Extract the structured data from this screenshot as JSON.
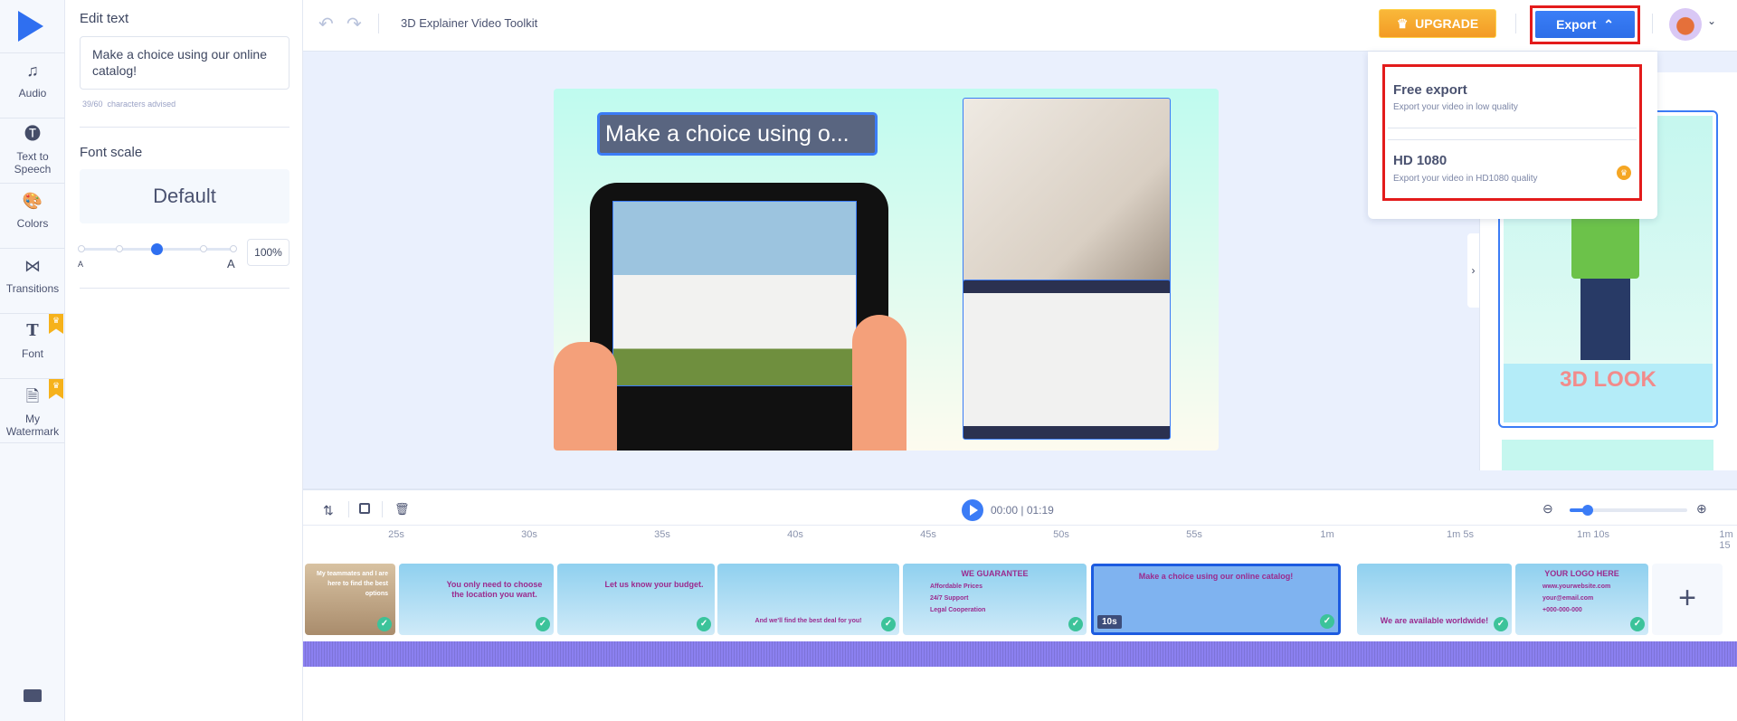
{
  "sidebar": {
    "items": [
      {
        "label": "Audio",
        "icon": "music-note-icon"
      },
      {
        "label": "Text to Speech",
        "icon": "text-speech-icon"
      },
      {
        "label": "Colors",
        "icon": "palette-icon"
      },
      {
        "label": "Transitions",
        "icon": "bowtie-icon"
      },
      {
        "label": "Font",
        "icon": "font-icon",
        "premium": true
      },
      {
        "label": "My Watermark",
        "icon": "watermark-icon",
        "premium": true
      }
    ]
  },
  "panel": {
    "edit_text_label": "Edit text",
    "text_value": "Make a choice using our online catalog!",
    "char_count": "39/60",
    "char_hint": "characters advised",
    "font_scale_label": "Font scale",
    "font_scale_value": "Default",
    "slider_min_label": "A",
    "slider_max_label": "A",
    "slider_percent": "100%",
    "slider_step": 3,
    "slider_steps": 5
  },
  "header": {
    "title": "3D Explainer Video Toolkit",
    "upgrade_label": "UPGRADE",
    "export_label": "Export"
  },
  "export_menu": {
    "items": [
      {
        "title": "Free export",
        "subtitle": "Export your video in low quality"
      },
      {
        "title": "HD 1080",
        "subtitle": "Export your video in HD1080 quality",
        "premium": true
      }
    ]
  },
  "canvas": {
    "text_overlay": "Make a choice using o..."
  },
  "right_panel": {
    "thumb_text": "3D LOOK"
  },
  "timeline": {
    "time_current": "00:00",
    "time_total": "01:19",
    "zoom_level": 0.15,
    "ticks": [
      "25s",
      "30s",
      "35s",
      "40s",
      "45s",
      "50s",
      "55s",
      "1m",
      "1m 5s",
      "1m 10s",
      "1m 15"
    ],
    "clips": [
      {
        "text": "My teammates and I are here to find the best options"
      },
      {
        "text": "You only need to choose the location you want."
      },
      {
        "text": "Let us know your budget."
      },
      {
        "text": "And we'll find the best deal for you!"
      },
      {
        "text": "WE GUARANTEE",
        "lines": [
          "Affordable Prices",
          "24/7 Support",
          "Legal Cooperation"
        ]
      },
      {
        "text": "Make a choice using our online catalog!",
        "duration": "10s",
        "selected": true
      },
      {
        "text": "We are available worldwide!"
      },
      {
        "text": "YOUR LOGO HERE",
        "lines": [
          "www.yourwebsite.com",
          "your@email.com",
          "+000-000-000"
        ]
      }
    ]
  },
  "colors": {
    "accent": "#3b7cf6",
    "upgrade": "#f5a623",
    "highlight": "#e31b1b",
    "audio": "#8b80f0"
  }
}
